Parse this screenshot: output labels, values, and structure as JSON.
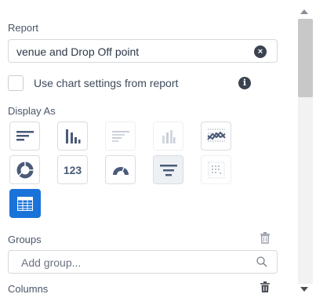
{
  "report": {
    "label": "Report",
    "value": "venue and Drop Off point"
  },
  "chart_settings": {
    "label": "Use chart settings from report",
    "checked": false
  },
  "display_as": {
    "label": "Display As",
    "options": [
      {
        "name": "bar-horizontal",
        "state": "enabled"
      },
      {
        "name": "bar-vertical",
        "state": "enabled"
      },
      {
        "name": "bar-horizontal-stacked",
        "state": "disabled"
      },
      {
        "name": "bar-vertical-stacked",
        "state": "disabled"
      },
      {
        "name": "line",
        "state": "enabled"
      },
      {
        "name": "donut",
        "state": "enabled"
      },
      {
        "name": "number",
        "label": "123",
        "state": "enabled"
      },
      {
        "name": "gauge",
        "state": "enabled"
      },
      {
        "name": "funnel",
        "state": "hover"
      },
      {
        "name": "scatter",
        "state": "disabled"
      },
      {
        "name": "table",
        "state": "selected"
      }
    ],
    "selected": "table"
  },
  "groups": {
    "label": "Groups",
    "placeholder": "Add group..."
  },
  "columns": {
    "label": "Columns"
  },
  "colors": {
    "accent": "#1a73d9",
    "icon": "#4a5a78",
    "text": "#3e4a5a"
  }
}
